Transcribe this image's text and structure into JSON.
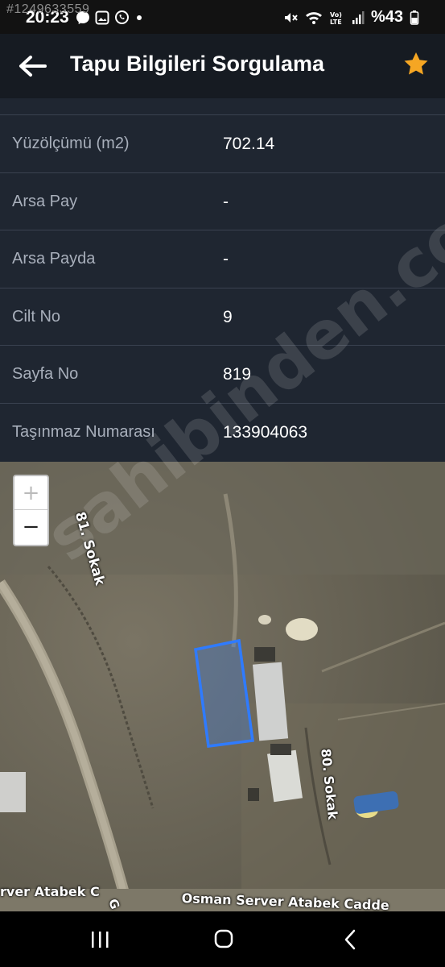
{
  "status_bar": {
    "overlay_id": "#1249633559",
    "time": "20:23",
    "battery_text": "%43",
    "icons": [
      "messenger-icon",
      "gallery-icon",
      "whatsapp-icon",
      "dot-icon",
      "mute-icon",
      "wifi-icon",
      "volte-icon",
      "signal-icon",
      "battery-icon"
    ]
  },
  "app_bar": {
    "title": "Tapu Bilgileri Sorgulama",
    "back_icon": "arrow-left-icon",
    "favorite_icon": "star-icon",
    "favorite_color": "#f5a623"
  },
  "info_rows": [
    {
      "label": "Yüzölçümü (m2)",
      "value": "702.14"
    },
    {
      "label": "Arsa Pay",
      "value": "-"
    },
    {
      "label": "Arsa Payda",
      "value": "-"
    },
    {
      "label": "Cilt No",
      "value": "9"
    },
    {
      "label": "Sayfa No",
      "value": "819"
    },
    {
      "label": "Taşınmaz Numarası",
      "value": "133904063"
    }
  ],
  "map": {
    "zoom_in_label": "+",
    "zoom_out_label": "−",
    "street_81": "81. Sokak",
    "street_80": "80. Sokak",
    "street_bottom_left": "rver Atabek C",
    "street_bottom_right": "Osman Server Atabek Cadde",
    "street_g": "G",
    "parcel_color": "#2f7bff"
  },
  "watermark": "sahibinden.com",
  "nav_bar": {
    "icons": [
      "recent-apps-icon",
      "home-icon",
      "back-icon"
    ]
  }
}
